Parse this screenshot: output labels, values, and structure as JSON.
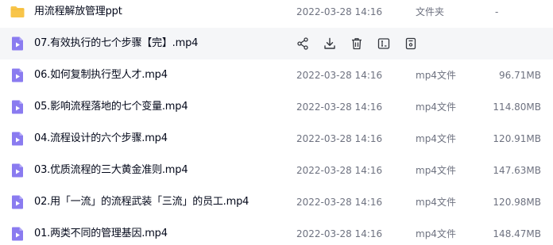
{
  "colors": {
    "folder": "#f8c54a",
    "video": "#8a7bf0",
    "hover_background": "#f5f6f8",
    "name_text": "#03081a",
    "meta_text": "#6e7280"
  },
  "icons": {
    "folder": "folder-icon",
    "video": "video-file-icon",
    "actions": [
      "share-icon",
      "download-icon",
      "delete-icon",
      "rename-icon",
      "more-icon"
    ]
  },
  "files": [
    {
      "name": "用流程解放管理ppt",
      "date": "2022-03-28 14:16",
      "type": "文件夹",
      "size": "-",
      "icon": "folder"
    },
    {
      "name": "07.有效执行的七个步骤【完】.mp4",
      "date": "",
      "type": "",
      "size": "",
      "icon": "video",
      "hovered": true
    },
    {
      "name": "06.如何复制执行型人才.mp4",
      "date": "2022-03-28 14:16",
      "type": "mp4文件",
      "size": "96.71MB",
      "icon": "video"
    },
    {
      "name": "05.影响流程落地的七个变量.mp4",
      "date": "2022-03-28 14:16",
      "type": "mp4文件",
      "size": "114.80MB",
      "icon": "video"
    },
    {
      "name": "04.流程设计的六个步骤.mp4",
      "date": "2022-03-28 14:16",
      "type": "mp4文件",
      "size": "120.91MB",
      "icon": "video"
    },
    {
      "name": "03.优质流程的三大黄金准则.mp4",
      "date": "2022-03-28 14:16",
      "type": "mp4文件",
      "size": "147.63MB",
      "icon": "video"
    },
    {
      "name": "02.用「一流」的流程武装「三流」的员工.mp4",
      "date": "2022-03-28 14:16",
      "type": "mp4文件",
      "size": "120.98MB",
      "icon": "video"
    },
    {
      "name": "01.两类不同的管理基因.mp4",
      "date": "2022-03-28 14:16",
      "type": "mp4文件",
      "size": "148.47MB",
      "icon": "video"
    }
  ]
}
